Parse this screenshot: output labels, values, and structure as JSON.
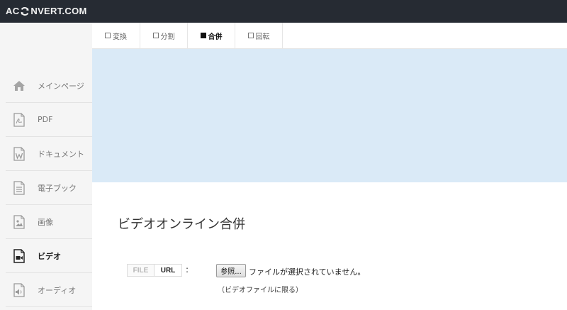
{
  "header": {
    "logo_left": "AC",
    "logo_right": "NVERT.COM"
  },
  "sidebar": {
    "items": [
      {
        "label": "メインページ",
        "icon": "home-icon"
      },
      {
        "label": "PDF",
        "icon": "pdf-file-icon"
      },
      {
        "label": "ドキュメント",
        "icon": "word-file-icon"
      },
      {
        "label": "電子ブック",
        "icon": "ebook-file-icon"
      },
      {
        "label": "画像",
        "icon": "image-file-icon"
      },
      {
        "label": "ビデオ",
        "icon": "video-file-icon",
        "active": true
      },
      {
        "label": "オーディオ",
        "icon": "audio-file-icon"
      }
    ]
  },
  "tabs": [
    {
      "label": "変換"
    },
    {
      "label": "分割"
    },
    {
      "label": "合併",
      "active": true
    },
    {
      "label": "回転"
    }
  ],
  "main": {
    "title": "ビデオオンライン合併",
    "source_toggle": {
      "file": "FILE",
      "url": "URL",
      "selected": "URL"
    },
    "colon": ":",
    "browse_button": "参照...",
    "file_status": "ファイルが選択されていません。",
    "hint": "（ビデオファイルに限る）"
  },
  "colors": {
    "header_bg": "#262b33",
    "sidebar_bg": "#f5f5f5",
    "banner_bg": "#daeaf7"
  }
}
